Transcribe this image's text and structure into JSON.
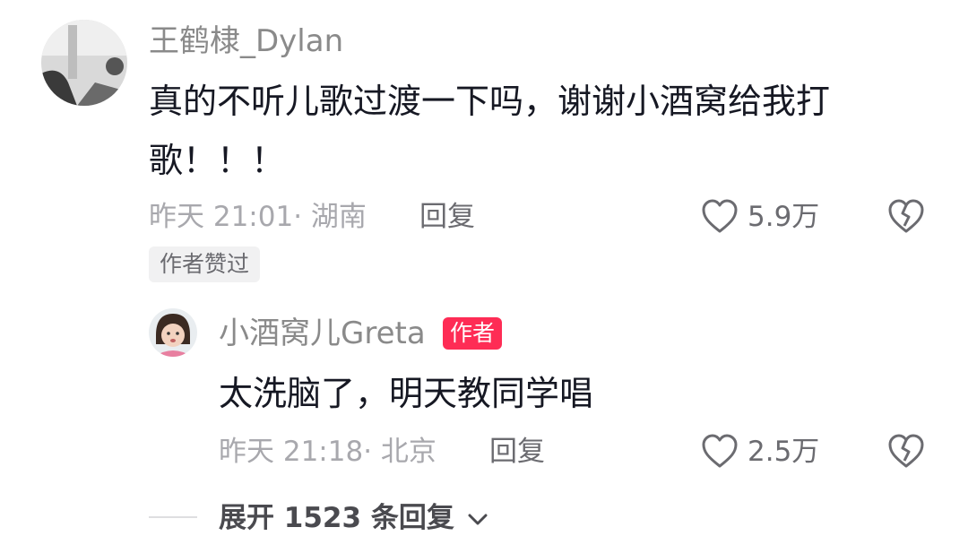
{
  "comment": {
    "username": "王鹤棣_Dylan",
    "text_line1": "真的不听儿歌过渡一下吗，谢谢小酒窝给我打",
    "text_line2": "歌！！！",
    "time": "昨天 21:01",
    "location": "湖南",
    "reply_label": "回复",
    "likes": "5.9万",
    "author_liked_tag": "作者赞过",
    "icons": {
      "like": "heart-outline-icon",
      "dislike": "broken-heart-icon"
    }
  },
  "reply": {
    "username": "小酒窝儿Greta",
    "author_badge": "作者",
    "text": "太洗脑了，明天教同学唱",
    "time": "昨天 21:18",
    "location": "北京",
    "reply_label": "回复",
    "likes": "2.5万",
    "icons": {
      "like": "heart-outline-icon",
      "dislike": "broken-heart-icon"
    }
  },
  "expand": {
    "label": "展开 1523 条回复",
    "icon": "chevron-down-icon"
  },
  "colors": {
    "text_primary": "#161823",
    "text_secondary": "#8a8a8a",
    "author_badge_bg": "#fe2c55"
  }
}
